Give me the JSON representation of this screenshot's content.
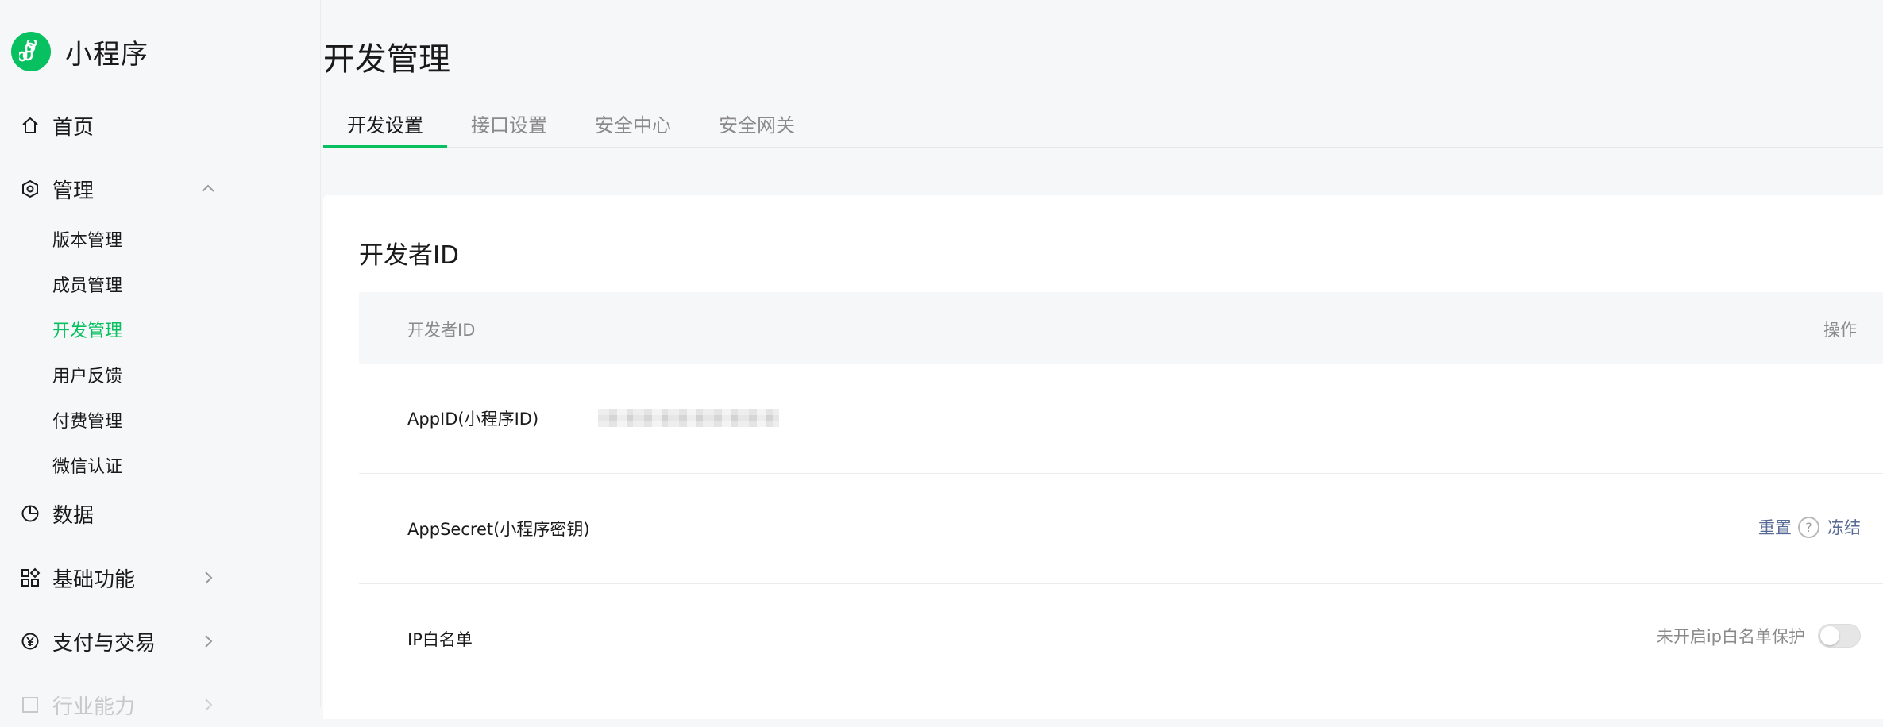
{
  "brand": {
    "name": "小程序",
    "logo_icon": "miniprogram-logo-icon",
    "accent": "#07c160"
  },
  "sidebar": {
    "items": [
      {
        "label": "首页",
        "icon": "home-icon"
      },
      {
        "label": "管理",
        "icon": "settings-hexagon-icon",
        "expanded": true,
        "children": [
          "版本管理",
          "成员管理",
          "开发管理",
          "用户反馈",
          "付费管理",
          "微信认证"
        ],
        "active_child": "开发管理"
      },
      {
        "label": "数据",
        "icon": "pie-chart-icon"
      },
      {
        "label": "基础功能",
        "icon": "grid-apps-icon"
      },
      {
        "label": "支付与交易",
        "icon": "yuan-circle-icon"
      },
      {
        "label": "行业能力",
        "icon": "industry-icon"
      }
    ]
  },
  "page": {
    "title": "开发管理"
  },
  "tabs": [
    {
      "label": "开发设置",
      "active": true
    },
    {
      "label": "接口设置",
      "active": false
    },
    {
      "label": "安全中心",
      "active": false
    },
    {
      "label": "安全网关",
      "active": false
    }
  ],
  "developer_id": {
    "title": "开发者ID",
    "columns": [
      "开发者ID",
      "操作"
    ],
    "rows": [
      {
        "label": "AppID(小程序ID)",
        "value_obscured": true
      },
      {
        "label": "AppSecret(小程序密钥)",
        "actions": [
          "重置",
          "冻结"
        ],
        "help_icon": "question-circle-icon"
      },
      {
        "label": "IP白名单",
        "status_text": "未开启ip白名单保护",
        "toggle_on": false
      }
    ]
  },
  "colors": {
    "link": "#576b95",
    "active_green": "#07c160",
    "muted": "#8a8a8a"
  }
}
